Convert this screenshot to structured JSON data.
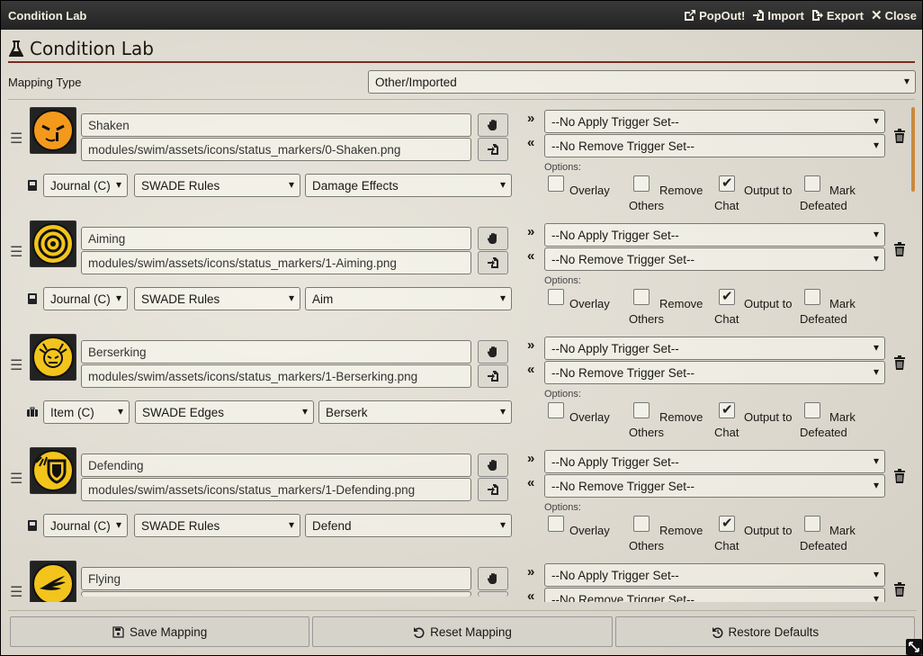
{
  "window": {
    "title": "Condition Lab"
  },
  "titlebar": {
    "popout": "PopOut!",
    "import": "Import",
    "export": "Export",
    "close": "Close"
  },
  "header": {
    "title": "Condition Lab"
  },
  "mapping": {
    "label": "Mapping Type",
    "value": "Other/Imported"
  },
  "options_label": "Options:",
  "checkbox_labels": {
    "overlay": "Overlay",
    "remove_others": [
      "Remove",
      "Others"
    ],
    "output_chat": [
      "Output to",
      "Chat"
    ],
    "mark_defeated": [
      "Mark",
      "Defeated"
    ]
  },
  "colors": {
    "accent": "#782e22",
    "scroll": "#c9893d",
    "icon_orange": "#f39a1c",
    "icon_yellow": "#f3c41c"
  },
  "conditions": [
    {
      "name": "Shaken",
      "icon": "shaken-face-icon",
      "icon_color": "#f39a1c",
      "path": "modules/swim/assets/icons/status_markers/0-Shaken.png",
      "type": "Journal (C)",
      "type_icon": "journal-icon",
      "compendium": "SWADE Rules",
      "entry": "Damage Effects",
      "apply_trigger": "--No Apply Trigger Set--",
      "remove_trigger": "--No Remove Trigger Set--",
      "overlay": false,
      "remove_others": false,
      "output_chat": true,
      "mark_defeated": false
    },
    {
      "name": "Aiming",
      "icon": "target-icon",
      "icon_color": "#f3c41c",
      "path": "modules/swim/assets/icons/status_markers/1-Aiming.png",
      "type": "Journal (C)",
      "type_icon": "journal-icon",
      "compendium": "SWADE Rules",
      "entry": "Aim",
      "apply_trigger": "--No Apply Trigger Set--",
      "remove_trigger": "--No Remove Trigger Set--",
      "overlay": false,
      "remove_others": false,
      "output_chat": true,
      "mark_defeated": false
    },
    {
      "name": "Berserking",
      "icon": "berserk-face-icon",
      "icon_color": "#f3c41c",
      "path": "modules/swim/assets/icons/status_markers/1-Berserking.png",
      "type": "Item (C)",
      "type_icon": "briefcase-icon",
      "compendium": "SWADE Edges",
      "entry": "Berserk",
      "apply_trigger": "--No Apply Trigger Set--",
      "remove_trigger": "--No Remove Trigger Set--",
      "overlay": false,
      "remove_others": false,
      "output_chat": true,
      "mark_defeated": false
    },
    {
      "name": "Defending",
      "icon": "shield-icon",
      "icon_color": "#f3c41c",
      "path": "modules/swim/assets/icons/status_markers/1-Defending.png",
      "type": "Journal (C)",
      "type_icon": "journal-icon",
      "compendium": "SWADE Rules",
      "entry": "Defend",
      "apply_trigger": "--No Apply Trigger Set--",
      "remove_trigger": "--No Remove Trigger Set--",
      "overlay": false,
      "remove_others": false,
      "output_chat": true,
      "mark_defeated": false
    },
    {
      "name": "Flying",
      "icon": "wing-icon",
      "icon_color": "#f3c41c",
      "path": "",
      "type": "",
      "type_icon": "",
      "compendium": "",
      "entry": "",
      "apply_trigger": "--No Apply Trigger Set--",
      "remove_trigger": "--No Remove Trigger Set--",
      "overlay": false,
      "remove_others": false,
      "output_chat": false,
      "mark_defeated": false
    }
  ],
  "footer": {
    "save": "Save Mapping",
    "reset": "Reset Mapping",
    "restore": "Restore Defaults"
  }
}
